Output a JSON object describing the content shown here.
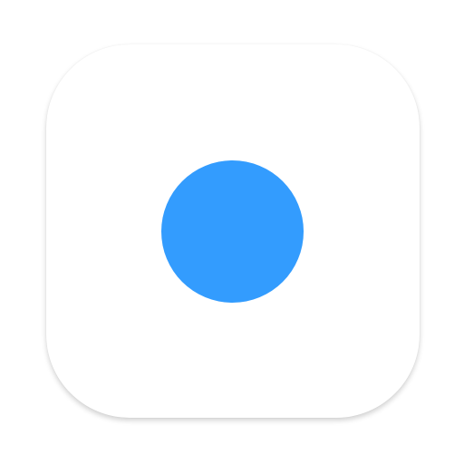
{
  "icon": {
    "name": "blue-dot-app-icon",
    "background_color": "#ffffff",
    "dot_color": "#339cfe"
  }
}
